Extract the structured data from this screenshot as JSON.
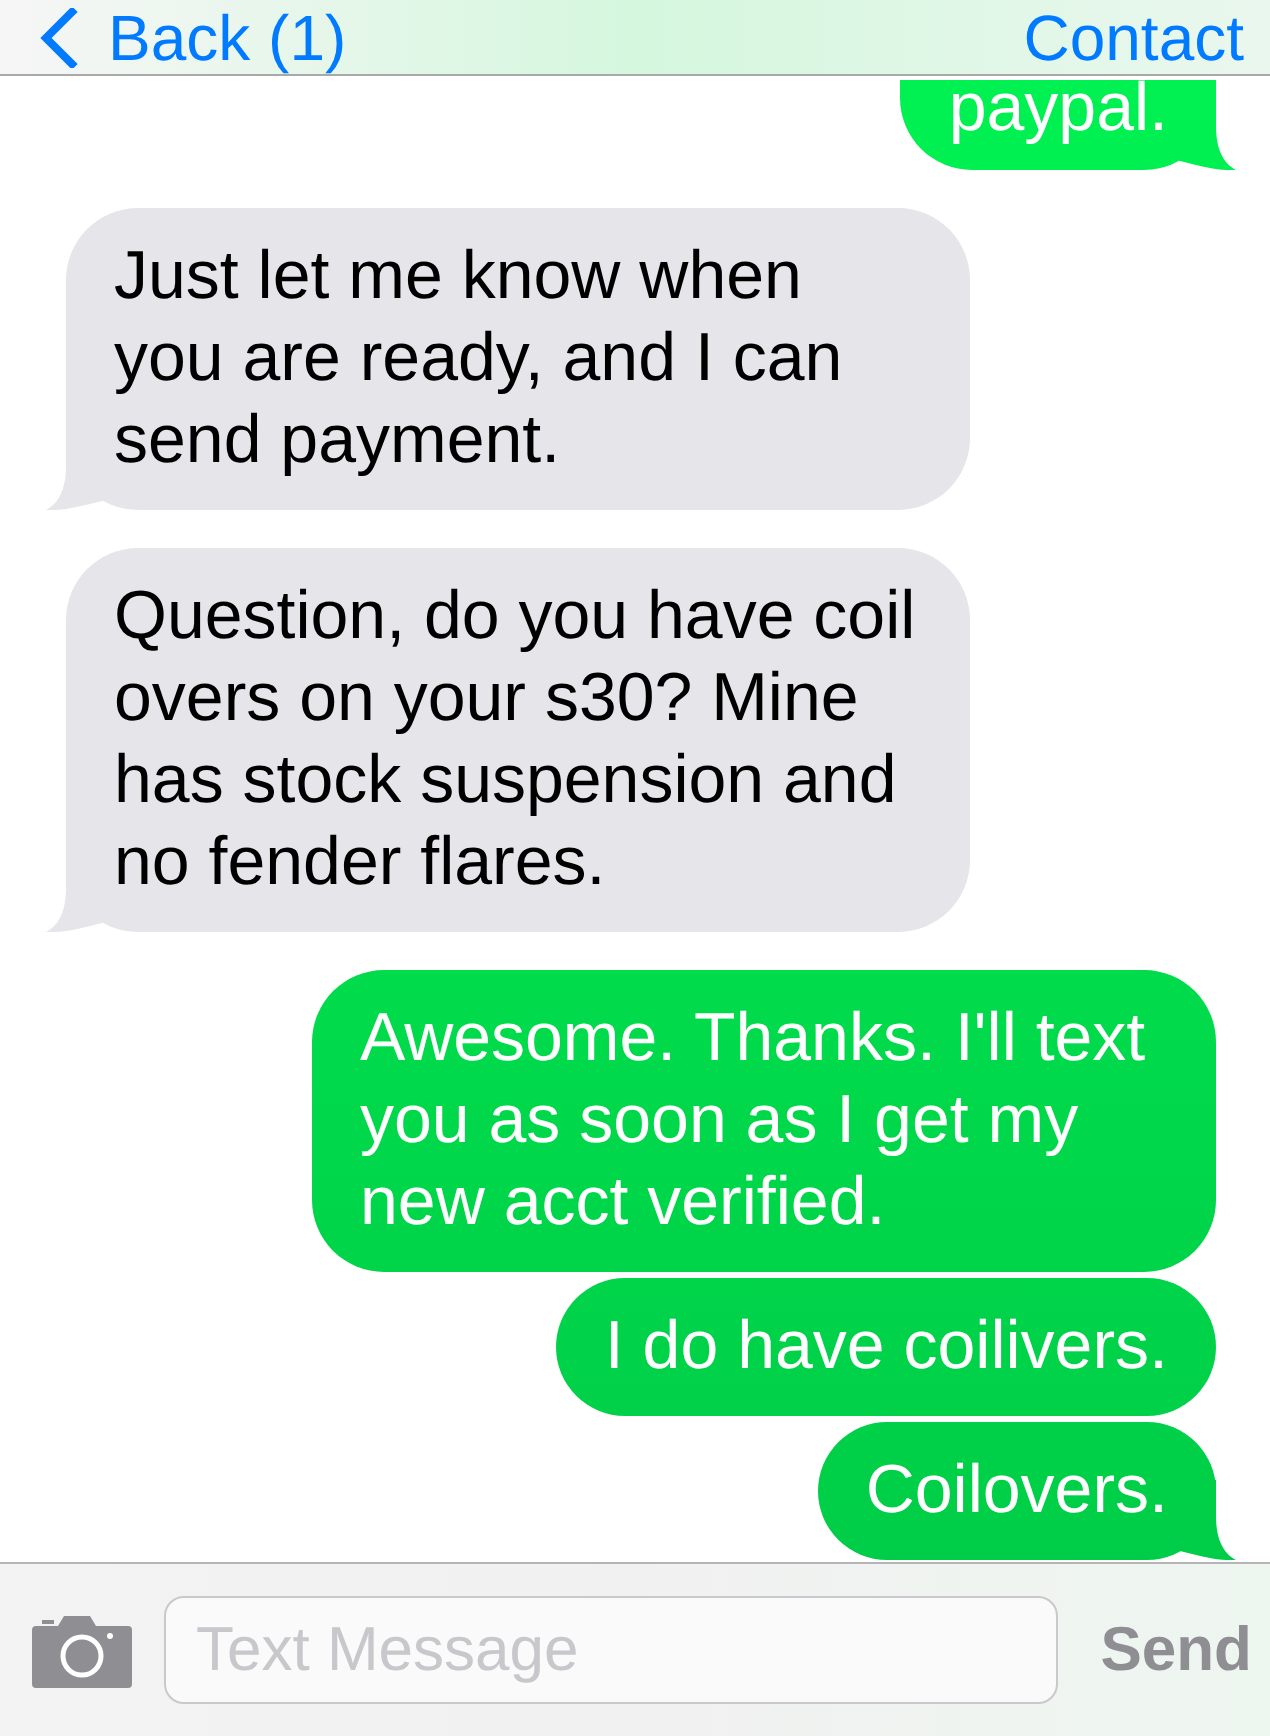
{
  "nav_bar": {
    "back_label": "Back (1)",
    "action_label": "Contact"
  },
  "messages": [
    {
      "kind": "sent",
      "text": "paypal.",
      "tail": true,
      "cut_off_top": true
    },
    {
      "kind": "received",
      "text": "Just let me know when you are ready, and I can send payment.",
      "tail": true,
      "cut_off_top": false
    },
    {
      "kind": "received",
      "text": "Question, do you have coil overs on your s30? Mine has stock suspension and no fender flares.",
      "tail": true,
      "cut_off_top": false
    },
    {
      "kind": "sent",
      "text": "Awesome. Thanks. I'll text you as soon as I get my new acct verified.",
      "tail": false,
      "cut_off_top": false
    },
    {
      "kind": "sent",
      "text": "I do have coilivers.",
      "tail": false,
      "cut_off_top": false
    },
    {
      "kind": "sent",
      "text": "Coilovers.",
      "tail": true,
      "cut_off_top": false
    }
  ],
  "composer": {
    "placeholder": "Text Message",
    "send_label": "Send",
    "send_disabled": true
  }
}
